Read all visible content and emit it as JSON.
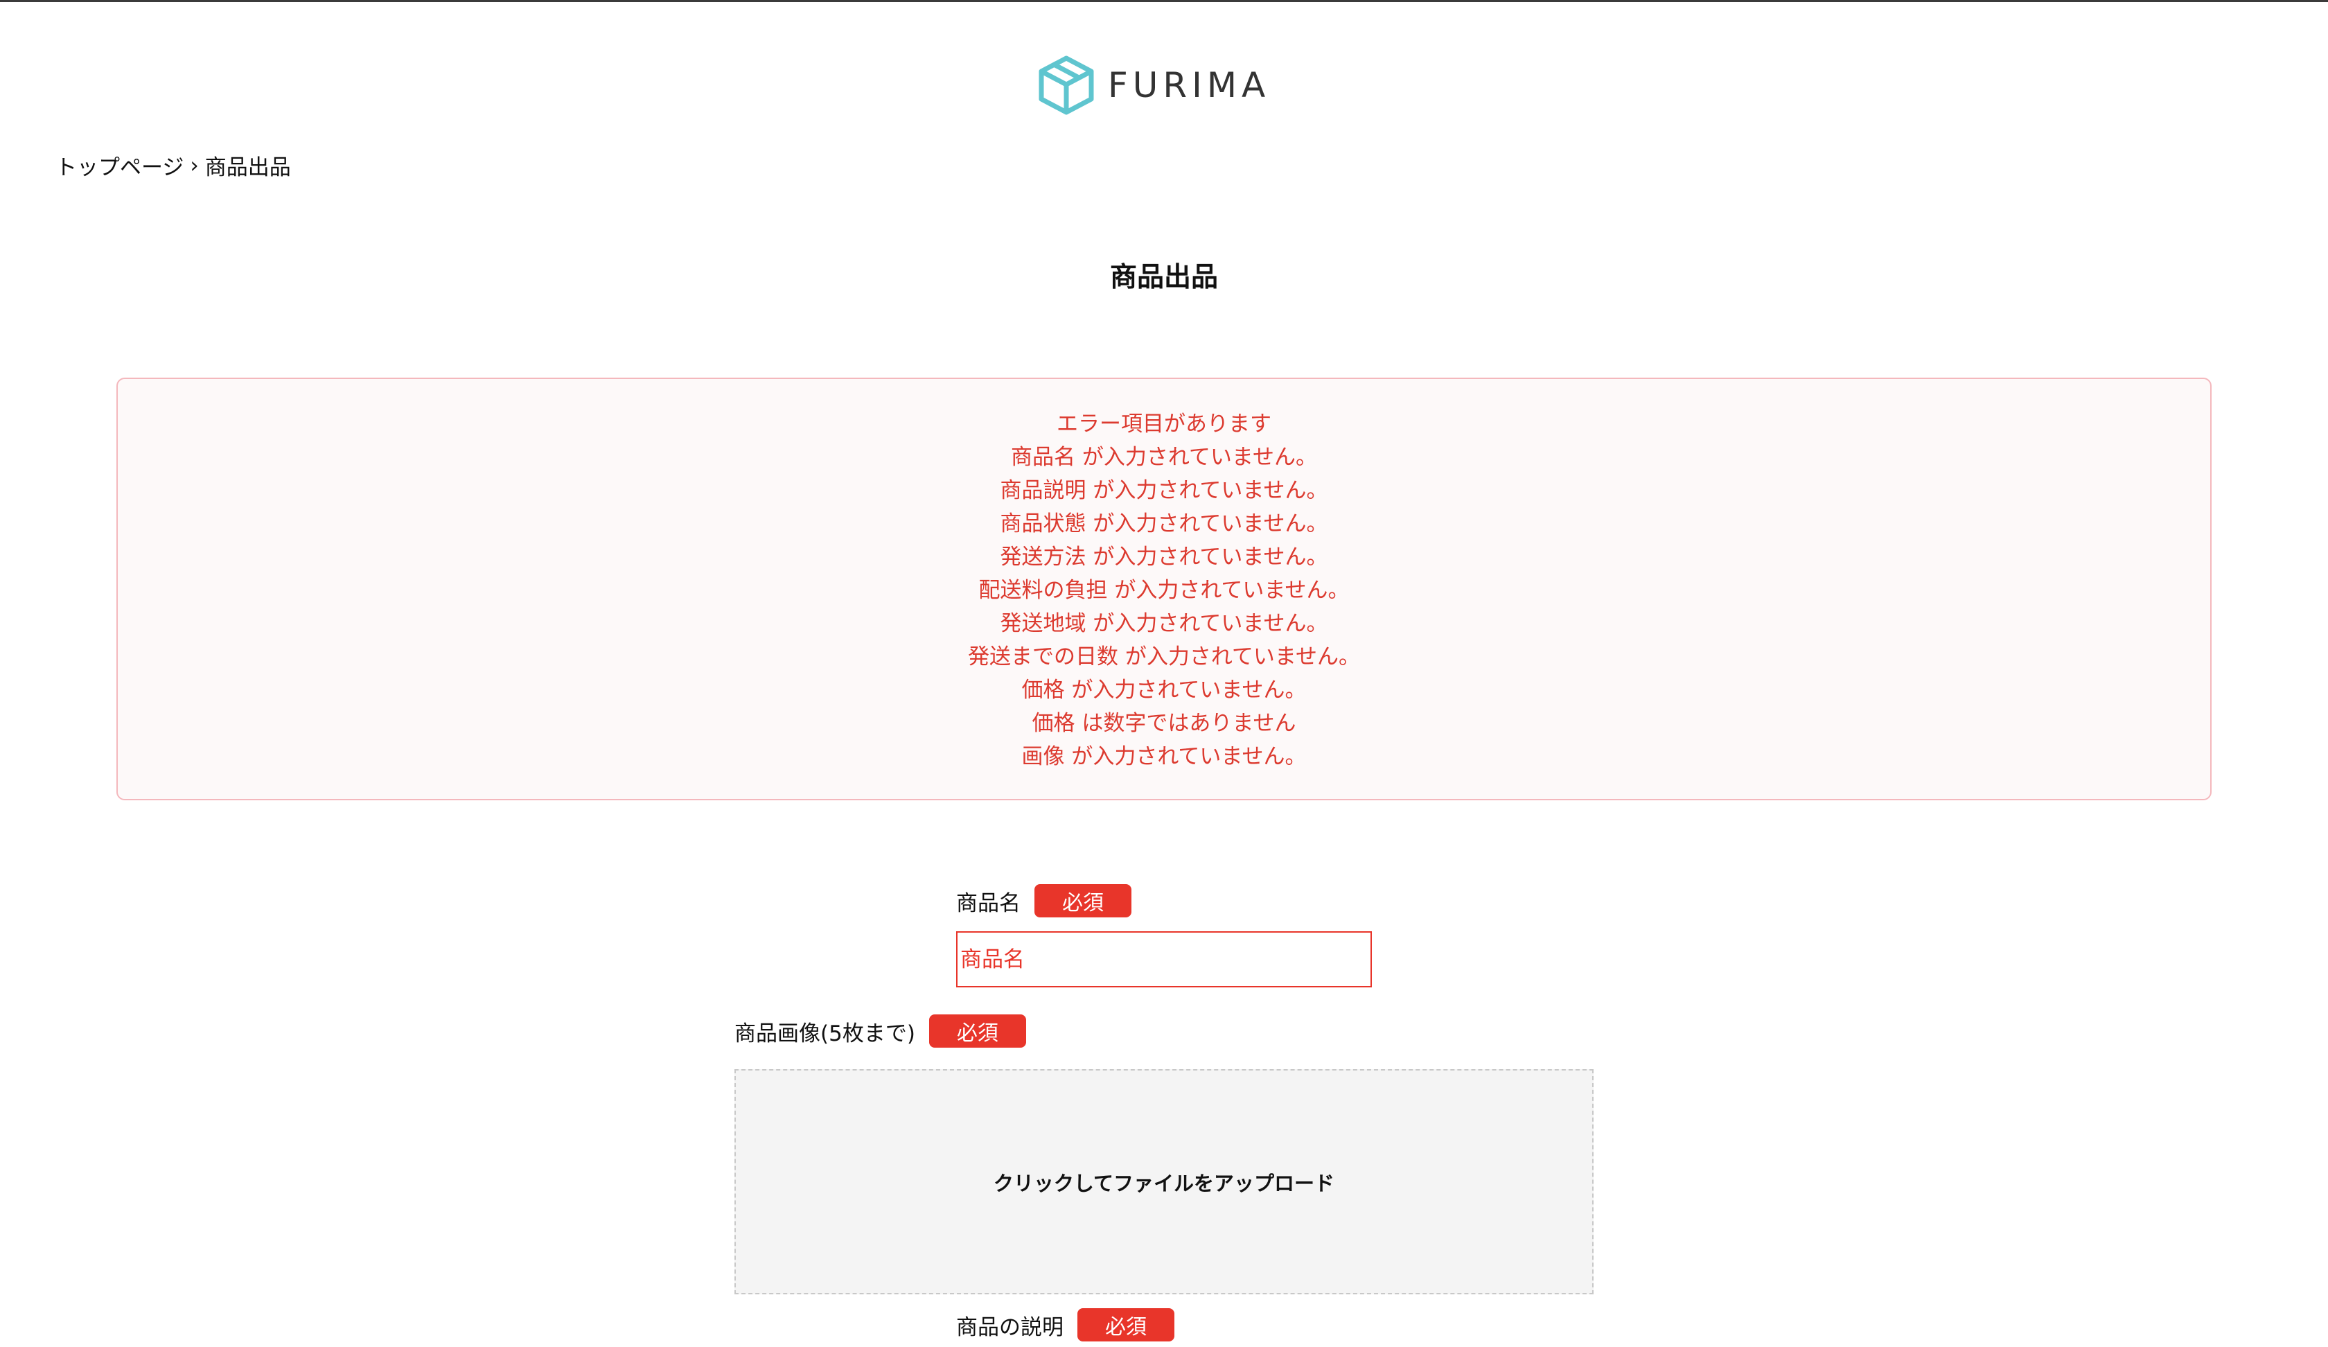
{
  "header": {
    "logo_text": "FURIMA",
    "brand_color": "#5fc5cf"
  },
  "breadcrumb": {
    "home": "トップページ",
    "separator": "›",
    "current": "商品出品"
  },
  "page": {
    "title": "商品出品"
  },
  "errors": {
    "heading": "エラー項目があります",
    "messages": [
      "商品名 が入力されていません。",
      "商品説明 が入力されていません。",
      "商品状態 が入力されていません。",
      "発送方法 が入力されていません。",
      "配送料の負担 が入力されていません。",
      "発送地域 が入力されていません。",
      "発送までの日数 が入力されていません。",
      "価格 が入力されていません。",
      "価格 は数字ではありません",
      "画像 が入力されていません。"
    ],
    "text_color": "#dc3a2f"
  },
  "form": {
    "required_label": "必須",
    "name": {
      "label": "商品名",
      "placeholder": "商品名",
      "value": ""
    },
    "images": {
      "label": "商品画像(5枚まで)",
      "upload_text": "クリックしてファイルをアップロード"
    },
    "description": {
      "label": "商品の説明"
    }
  }
}
